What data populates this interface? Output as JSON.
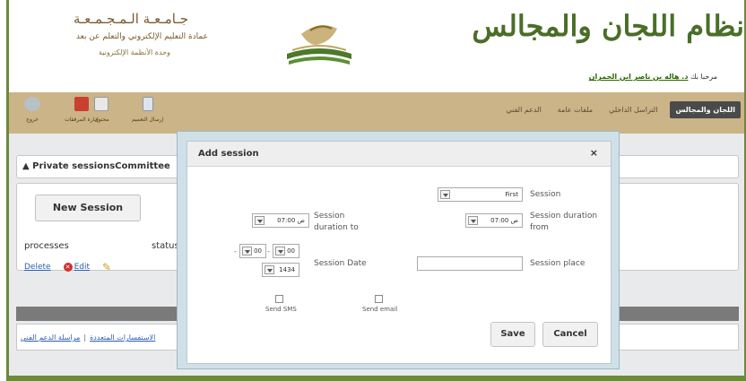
{
  "header": {
    "university_name": "جـامـعـة الـمـجـمـعـة",
    "deanship": "عمادة التعليم الإلكتروني والتعلم عن بعد",
    "unit": "وحدة الأنظمة الإلكترونية",
    "system_title": "نظام اللجان والمجالس",
    "welcome_prefix": "مرحبا بك",
    "welcome_user": "د. هاله بن ناصر ابن الحمران"
  },
  "toolbar": [
    {
      "icon": "exit-icon",
      "label": "خروج"
    },
    {
      "icon": "attachments-icon",
      "label": "إدارة المرفقات"
    },
    {
      "icon": "text-icon",
      "label": "محتوى"
    },
    {
      "icon": "document-icon",
      "label": "إرسال التعميم"
    }
  ],
  "nav": {
    "tabs": [
      {
        "label": "اللجان والمجالس",
        "active": true
      },
      {
        "label": "التراسل الداخلي",
        "active": false
      },
      {
        "label": "ملفات عامة",
        "active": false
      },
      {
        "label": "الدعم الفني",
        "active": false
      }
    ]
  },
  "main": {
    "page_title": "Private sessionsCommittee",
    "new_session_label": "New Session",
    "columns": [
      "processes",
      "status"
    ],
    "row_actions": {
      "delete": "Delete",
      "edit": "Edit"
    }
  },
  "footer": {
    "links": [
      "الاستفسارات المتعددة",
      "مراسلة الدعم الفني"
    ]
  },
  "modal": {
    "title": "Add session",
    "close": "×",
    "session_label": "Session",
    "session_value": "First",
    "duration_from_label": "Session duration from",
    "duration_from_value": "07:00 ص",
    "duration_to_label": "Session duration to",
    "duration_to_value": "07:00 ص",
    "date_label": "Session Date",
    "date_day": "00",
    "date_month": "00",
    "date_year": "1434",
    "place_label": "Session place",
    "place_value": "",
    "send_sms_label": "Send SMS",
    "send_email_label": "Send email",
    "save_label": "Save",
    "cancel_label": "Cancel"
  },
  "colors": {
    "frame_green": "#6b8a3a",
    "band_tan": "#cbb488",
    "title_green": "#4a6e28",
    "link_blue": "#2a5db0"
  }
}
